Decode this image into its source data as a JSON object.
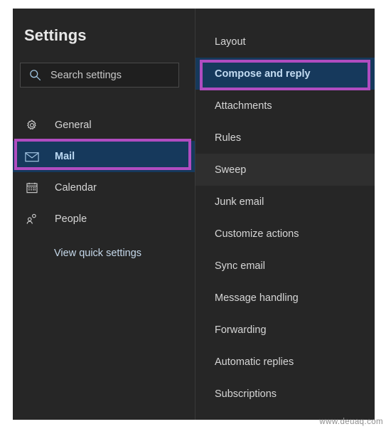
{
  "dialog": {
    "title": "Settings",
    "accent_highlight_color": "#b04cc0",
    "selected_bg_color": "#16395c",
    "panel_bg_color": "#262626"
  },
  "search": {
    "icon": "search-icon",
    "placeholder": "Search settings",
    "value": ""
  },
  "nav": {
    "items": [
      {
        "label": "General",
        "icon": "gear-icon",
        "selected": false
      },
      {
        "label": "Mail",
        "icon": "envelope-icon",
        "selected": true
      },
      {
        "label": "Calendar",
        "icon": "calendar-icon",
        "selected": false
      },
      {
        "label": "People",
        "icon": "people-icon",
        "selected": false
      }
    ],
    "quick_settings_link": "View quick settings"
  },
  "categories": {
    "items": [
      {
        "label": "Layout",
        "selected": false,
        "hovered": false
      },
      {
        "label": "Compose and reply",
        "selected": true,
        "hovered": false
      },
      {
        "label": "Attachments",
        "selected": false,
        "hovered": false
      },
      {
        "label": "Rules",
        "selected": false,
        "hovered": false
      },
      {
        "label": "Sweep",
        "selected": false,
        "hovered": true
      },
      {
        "label": "Junk email",
        "selected": false,
        "hovered": false
      },
      {
        "label": "Customize actions",
        "selected": false,
        "hovered": false
      },
      {
        "label": "Sync email",
        "selected": false,
        "hovered": false
      },
      {
        "label": "Message handling",
        "selected": false,
        "hovered": false
      },
      {
        "label": "Forwarding",
        "selected": false,
        "hovered": false
      },
      {
        "label": "Automatic replies",
        "selected": false,
        "hovered": false
      },
      {
        "label": "Subscriptions",
        "selected": false,
        "hovered": false
      }
    ]
  },
  "watermark": {
    "text": "www.deuaq.com"
  }
}
